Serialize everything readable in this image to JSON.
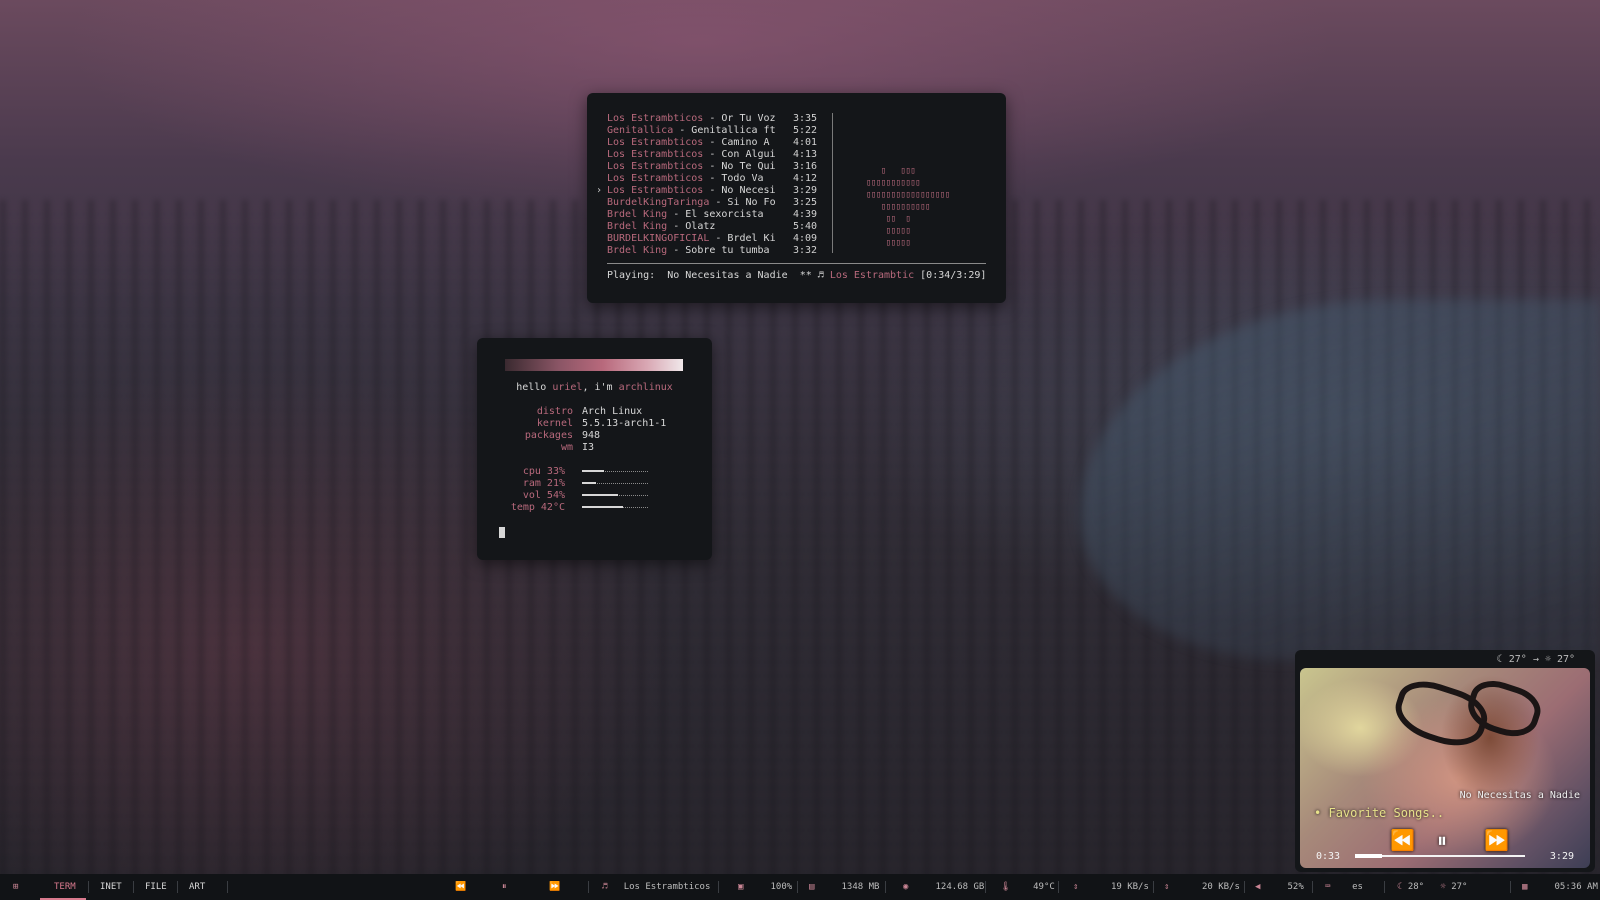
{
  "playlist": [
    {
      "artist": "Los Estrambticos",
      "title": "Or Tu Voz",
      "dur": "3:35",
      "current": false
    },
    {
      "artist": "Genitallica",
      "title": "Genitallica ft",
      "dur": "5:22",
      "current": false
    },
    {
      "artist": "Los Estrambticos",
      "title": "Camino A",
      "dur": "4:01",
      "current": false
    },
    {
      "artist": "Los Estrambticos",
      "title": "Con Algui",
      "dur": "4:13",
      "current": false
    },
    {
      "artist": "Los Estrambticos",
      "title": "No Te Qui",
      "dur": "3:16",
      "current": false
    },
    {
      "artist": "Los Estrambticos",
      "title": "Todo Va",
      "dur": "4:12",
      "current": false
    },
    {
      "artist": "Los Estrambticos",
      "title": "No Necesi",
      "dur": "3:29",
      "current": true
    },
    {
      "artist": "BurdelKingTaringa",
      "title": "Si No Fo",
      "dur": "3:25",
      "current": false
    },
    {
      "artist": "Brdel King",
      "title": "El sexorcista",
      "dur": "4:39",
      "current": false
    },
    {
      "artist": "Brdel King",
      "title": "Olatz",
      "dur": "5:40",
      "current": false
    },
    {
      "artist": "BURDELKINGOFICIAL",
      "title": "Brdel Ki",
      "dur": "4:09",
      "current": false
    },
    {
      "artist": "Brdel King",
      "title": "Sobre tu tumba",
      "dur": "3:32",
      "current": false
    }
  ],
  "visualizer": [
    "   ▯   ▯▯▯",
    "▯▯▯▯▯▯▯▯▯▯▯",
    "▯▯▯▯▯▯▯▯▯▯▯▯▯▯▯▯▯",
    "   ▯▯▯▯▯▯▯▯▯▯",
    "    ▯▯  ▯",
    "    ▯▯▯▯▯",
    "    ▯▯▯▯▯"
  ],
  "nowplaying": {
    "label": "Playing:",
    "title": "No Necesitas a Nadie",
    "stars": "**",
    "note": "♬",
    "artist": "Los Estrambtic",
    "time": "[0:34/3:29]"
  },
  "fetch": {
    "hello_prefix": "hello",
    "user": "uriel",
    "hello_mid": ", i'm",
    "host": "archlinux",
    "info": [
      {
        "key": "distro",
        "value": "Arch Linux"
      },
      {
        "key": "kernel",
        "value": "5.5.13-arch1-1"
      },
      {
        "key": "packages",
        "value": "948"
      },
      {
        "key": "wm",
        "value": "I3"
      }
    ],
    "stats": [
      {
        "label": "cpu 33%",
        "fraction": 0.33
      },
      {
        "label": "ram 21%",
        "fraction": 0.21
      },
      {
        "label": "vol 54%",
        "fraction": 0.54
      },
      {
        "label": "temp 42°C",
        "fraction": 0.62
      }
    ]
  },
  "widget": {
    "weather_now": "27°",
    "arrow": "→",
    "weather_next": "27°",
    "title": "No Necesitas a Nadie",
    "playlist": "Favorite Songs..",
    "bullet": "•",
    "elapsed": "0:33",
    "total": "3:29",
    "progress": 0.16,
    "prev": "⏪",
    "pause": "⏸",
    "next": "⏩"
  },
  "bar": {
    "menu_icon": "grid-icon",
    "tabs": [
      "TERM",
      "INET",
      "FILE",
      "ART"
    ],
    "prev": "⏪",
    "pause": "⏸",
    "next": "⏩",
    "music_icon": "♬",
    "artist": "Los Estrambticos",
    "cpu": "100%",
    "mem": "1348 MB",
    "disk": "124.68 GB",
    "temp": "49°C",
    "down": "19 KB/s",
    "up": "20 KB/s",
    "vol": "52%",
    "lang": "es",
    "weather_a": "28°",
    "weather_b": "27°",
    "clock": "05:36 AM",
    "colors": {
      "accent": "#d97a8e",
      "artist": "#b8697c"
    }
  }
}
